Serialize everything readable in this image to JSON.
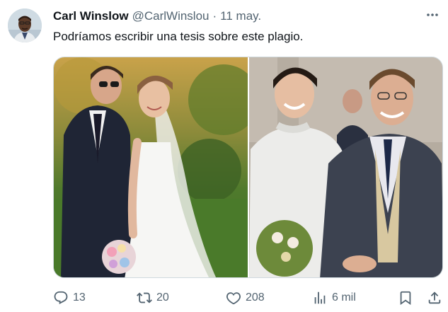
{
  "author": {
    "name": "Carl Winslow",
    "handle": "@CarlWinslou",
    "separator": "·",
    "date": "11 may."
  },
  "tweet": {
    "text": "Podríamos escribir una tesis sobre este plagio."
  },
  "media": {
    "images": [
      {
        "icon": "wedding-photo-left"
      },
      {
        "icon": "wedding-photo-right"
      }
    ]
  },
  "actions": {
    "replies": "13",
    "reposts": "20",
    "likes": "208",
    "views": "6 mil"
  },
  "colors": {
    "text": "#0f1419",
    "secondary": "#536471",
    "border": "#cfd9de"
  }
}
